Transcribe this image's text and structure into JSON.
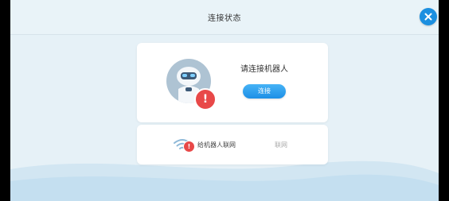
{
  "header": {
    "title": "连接状态"
  },
  "close": {
    "icon": "close-icon"
  },
  "robot_card": {
    "prompt": "请连接机器人",
    "connect_label": "连接",
    "status_icon": "alert-icon",
    "alert_mark": "!"
  },
  "network_card": {
    "label": "给机器人联网",
    "action_label": "联网",
    "icon": "wifi-icon",
    "alert_mark": "!"
  },
  "colors": {
    "accent": "#1b8fe0",
    "alert": "#e84848",
    "background": "#e6f1f7"
  }
}
